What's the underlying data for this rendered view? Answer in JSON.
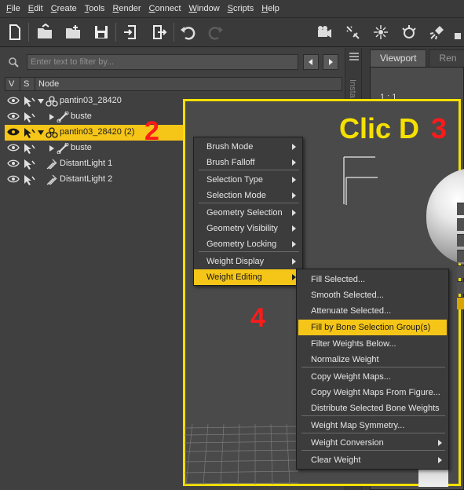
{
  "menubar": [
    "File",
    "Edit",
    "Create",
    "Tools",
    "Render",
    "Connect",
    "Window",
    "Scripts",
    "Help"
  ],
  "filter": {
    "placeholder": "Enter text to filter by..."
  },
  "columns": {
    "v": "V",
    "s": "S",
    "node": "Node"
  },
  "tree": [
    {
      "label": "pantin03_28420",
      "selected": false
    },
    {
      "label": "buste",
      "selected": false
    },
    {
      "label": "pantin03_28420 (2)",
      "selected": true
    },
    {
      "label": "buste",
      "selected": false
    },
    {
      "label": "DistantLight 1",
      "selected": false
    },
    {
      "label": "DistantLight 2",
      "selected": false
    }
  ],
  "sidetab": "Insta",
  "tabs": [
    "Viewport",
    "Ren"
  ],
  "viewport_label": "1 : 1",
  "annotations": {
    "n2": "2",
    "clic": "Clic D",
    "n3": "3",
    "n4": "4"
  },
  "context_menu": [
    {
      "label": "Brush Mode",
      "submenu": true
    },
    {
      "label": "Brush Falloff",
      "submenu": true
    },
    {
      "label": "Selection Type",
      "submenu": true
    },
    {
      "label": "Selection Mode",
      "submenu": true
    },
    {
      "label": "Geometry Selection",
      "submenu": true
    },
    {
      "label": "Geometry Visibility",
      "submenu": true
    },
    {
      "label": "Geometry Locking",
      "submenu": true
    },
    {
      "label": "Weight Display",
      "submenu": true
    },
    {
      "label": "Weight Editing",
      "submenu": true,
      "highlighted": true
    }
  ],
  "submenu": [
    {
      "label": "Fill Selected..."
    },
    {
      "label": "Smooth Selected..."
    },
    {
      "label": "Attenuate Selected..."
    },
    {
      "label": "Fill by Bone Selection Group(s)",
      "highlighted": true
    },
    {
      "label": "Filter Weights Below..."
    },
    {
      "label": "Normalize Weight"
    },
    {
      "label": "Copy Weight Maps..."
    },
    {
      "label": "Copy Weight Maps From Figure..."
    },
    {
      "label": "Distribute Selected Bone Weights"
    },
    {
      "label": "Weight Map Symmetry..."
    },
    {
      "label": "Weight Conversion",
      "submenu": true
    },
    {
      "label": "Clear Weight",
      "submenu": true
    }
  ],
  "colors": {
    "highlight": "#f5c518",
    "frame": "#f5e000",
    "annotation": "#ff1a1a"
  }
}
